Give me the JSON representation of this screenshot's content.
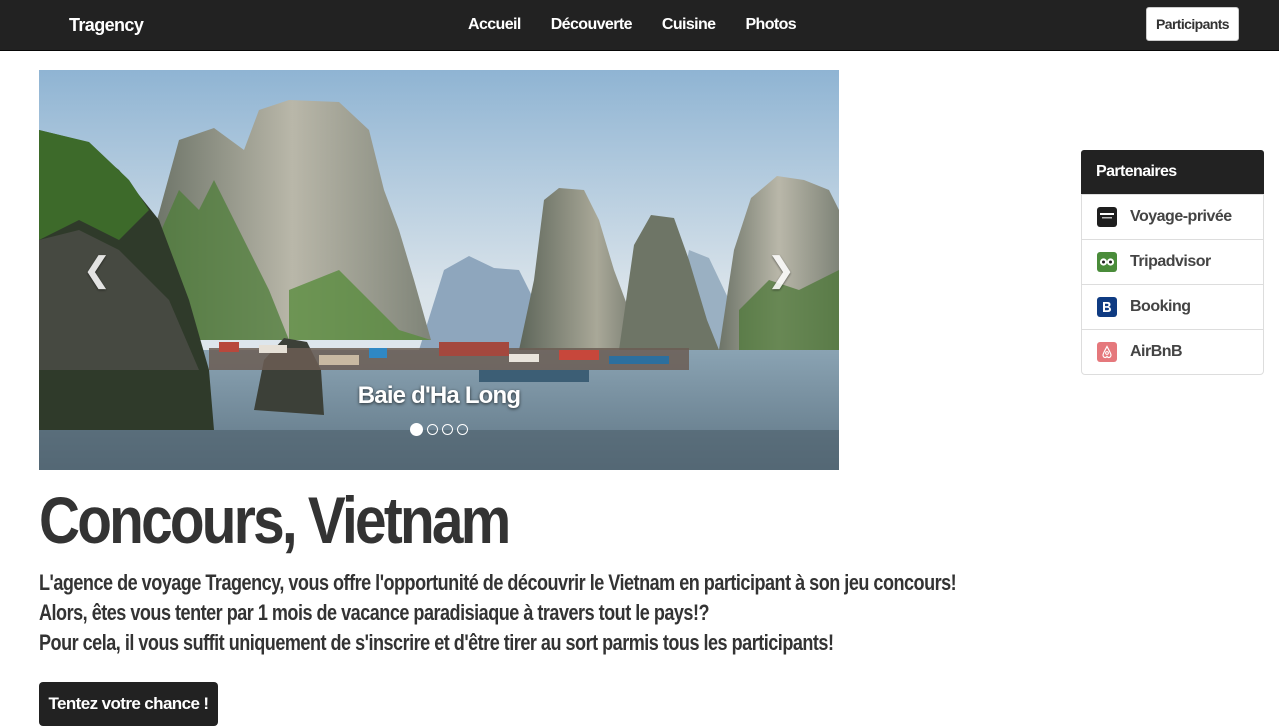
{
  "navbar": {
    "brand": "Tragency",
    "links": [
      "Accueil",
      "Découverte",
      "Cuisine",
      "Photos"
    ],
    "participants_label": "Participants"
  },
  "carousel": {
    "caption": "Baie d'Ha Long",
    "prev_icon": "chevron-left-icon",
    "next_icon": "chevron-right-icon",
    "slide_count": 4,
    "active_index": 0
  },
  "hero": {
    "title": "Concours, Vietnam",
    "lines": [
      "L'agence de voyage Tragency, vous offre l'opportunité de découvrir le Vietnam en participant à son jeu concours!",
      "Alors, êtes vous tenter par 1 mois de vacance paradisiaque à travers tout le pays!?",
      "Pour cela, il vous suffit uniquement de s'inscrire et d'être tirer au sort parmis tous les participants!"
    ],
    "cta_label": "Tentez votre chance !"
  },
  "partners": {
    "heading": "Partenaires",
    "items": [
      {
        "label": "Voyage-privée",
        "icon": "voyage-privee-logo-icon",
        "color": "#1e1e1e"
      },
      {
        "label": "Tripadvisor",
        "icon": "tripadvisor-owl-icon",
        "color": "#4a8c3a"
      },
      {
        "label": "Booking",
        "icon": "booking-b-icon",
        "color": "#0f3b82"
      },
      {
        "label": "AirBnB",
        "icon": "airbnb-logo-icon",
        "color": "#e5787c"
      }
    ]
  },
  "colors": {
    "navbar_bg": "#222222",
    "text": "#333333",
    "cta_bg": "#222222"
  }
}
